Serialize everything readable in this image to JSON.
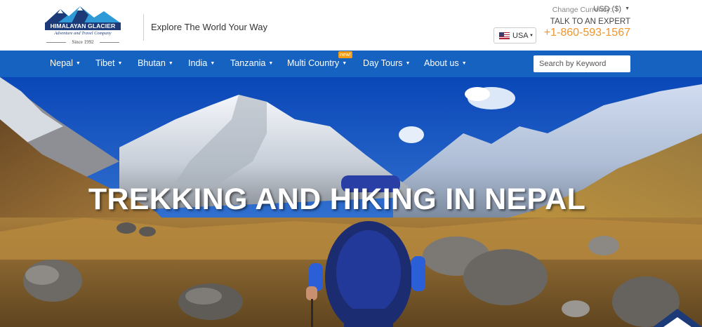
{
  "brand": {
    "name": "HIMALAYAN GLACIER",
    "subtitle": "Adventure and Travel Company",
    "since": "Since 1992"
  },
  "header": {
    "tagline": "Explore The World Your Way",
    "currency_label": "Change Currency:",
    "currency_value": "USD ($)",
    "country": "USA",
    "talk_label": "TALK TO AN EXPERT",
    "phone": "+1-860-593-1567"
  },
  "nav": {
    "items": [
      {
        "label": "Nepal"
      },
      {
        "label": "Tibet"
      },
      {
        "label": "Bhutan"
      },
      {
        "label": "India"
      },
      {
        "label": "Tanzania"
      },
      {
        "label": "Multi Country"
      },
      {
        "label": "Day Tours"
      },
      {
        "label": "About us"
      }
    ],
    "new_badge": "new!",
    "search_placeholder": "Search by Keyword"
  },
  "hero": {
    "title": "TREKKING AND HIKING IN NEPAL"
  },
  "colors": {
    "nav_blue": "#1562c0",
    "phone_orange": "#f0962a",
    "brand_navy": "#1d3a78",
    "badge_orange": "#f39c12"
  },
  "icons": [
    "mountain-logo-icon",
    "us-flag-icon",
    "caret-down-icon"
  ]
}
